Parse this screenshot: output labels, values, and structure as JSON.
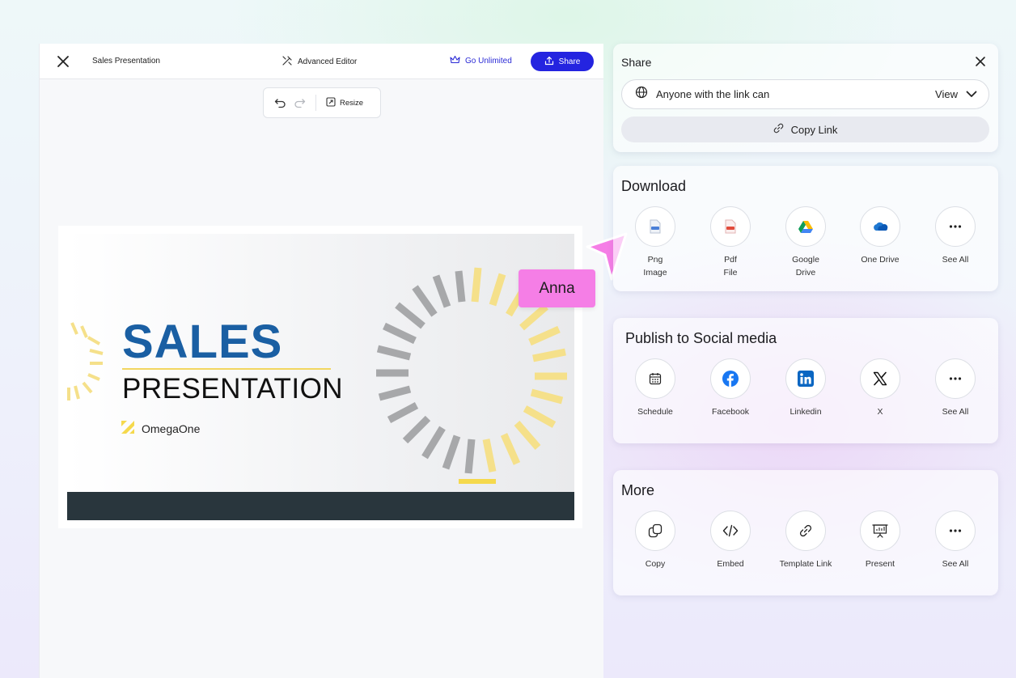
{
  "editor": {
    "doc_title": "Sales Presentation",
    "advanced_editor": "Advanced Editor",
    "go_unlimited": "Go Unlimited",
    "share": "Share",
    "resize": "Resize"
  },
  "slide": {
    "title": "SALES",
    "subtitle": "PRESENTATION",
    "brand": "OmegaOne",
    "colors": {
      "title": "#1a5fa3",
      "accent_yellow": "#f2d660",
      "footer": "#29363d"
    }
  },
  "collaborator": {
    "name": "Anna",
    "color": "#f57ee6"
  },
  "share_panel": {
    "title": "Share",
    "access_text": "Anyone with the link can",
    "access_value": "View",
    "copy_link": "Copy Link"
  },
  "download_panel": {
    "title": "Download",
    "options": [
      {
        "label": "Png\nImage",
        "icon": "png-file-icon"
      },
      {
        "label": "Pdf\nFile",
        "icon": "pdf-file-icon"
      },
      {
        "label": "Google\nDrive",
        "icon": "google-drive-icon"
      },
      {
        "label": "One Drive",
        "icon": "onedrive-icon"
      },
      {
        "label": "See All",
        "icon": "more-icon"
      }
    ]
  },
  "social_panel": {
    "title": "Publish to Social media",
    "options": [
      {
        "label": "Schedule",
        "icon": "calendar-icon"
      },
      {
        "label": "Facebook",
        "icon": "facebook-icon"
      },
      {
        "label": "Linkedin",
        "icon": "linkedin-icon"
      },
      {
        "label": "X",
        "icon": "x-icon"
      },
      {
        "label": "See All",
        "icon": "more-icon"
      }
    ]
  },
  "more_panel": {
    "title": "More",
    "options": [
      {
        "label": "Copy",
        "icon": "copy-icon"
      },
      {
        "label": "Embed",
        "icon": "code-icon"
      },
      {
        "label": "Template Link",
        "icon": "link-icon"
      },
      {
        "label": "Present",
        "icon": "presentation-icon"
      },
      {
        "label": "See All",
        "icon": "more-icon"
      }
    ]
  },
  "colors": {
    "primary": "#2424e0",
    "link": "#2b2bd6"
  }
}
